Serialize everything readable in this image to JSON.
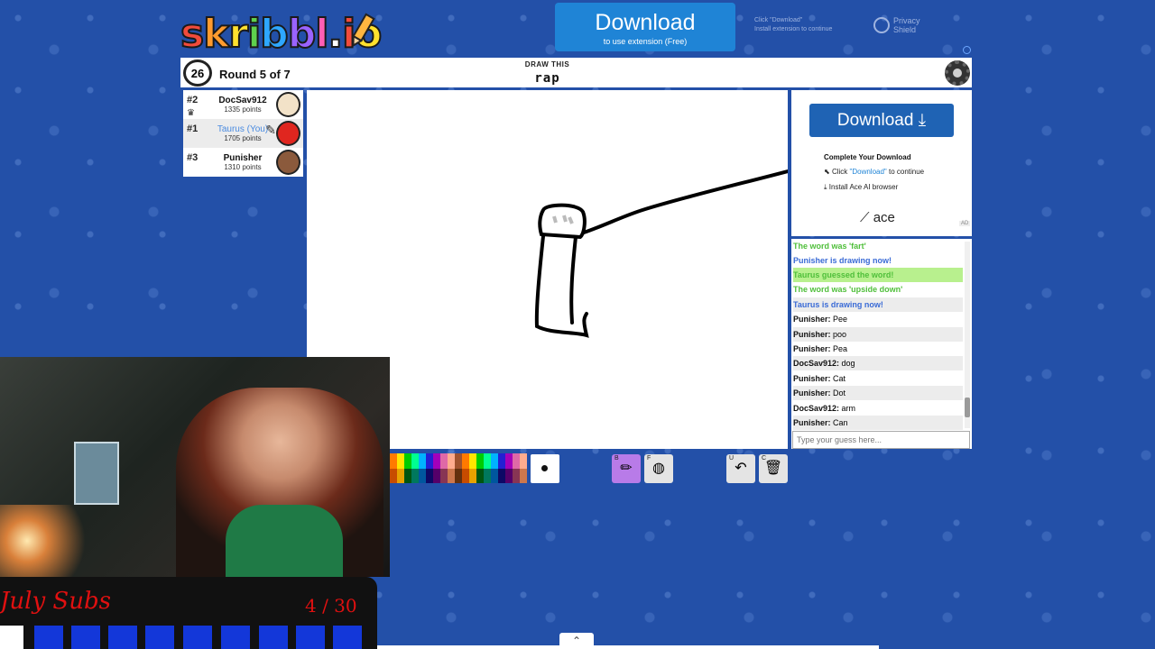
{
  "logo": {
    "text": "skribbl.io"
  },
  "top_ad": {
    "download_label": "Download",
    "sub_label": "to use extension (Free)",
    "extra_line1": "Click \"Download\"",
    "extra_line2": "Install extension to continue",
    "privacy_label": "Privacy Shield"
  },
  "game": {
    "timer": "26",
    "round_label": "Round 5 of 7",
    "draw_this": "DRAW THIS",
    "word": "rap"
  },
  "players": [
    {
      "rank": "#2",
      "name": "DocSav912",
      "points": "1335 points",
      "avatar_color": "#f2e2c8"
    },
    {
      "rank": "#1",
      "name": "Taurus (You)",
      "points": "1705 points",
      "avatar_color": "#e0261f",
      "is_you": true
    },
    {
      "rank": "#3",
      "name": "Punisher",
      "points": "1310 points",
      "avatar_color": "#8b5a3c"
    }
  ],
  "ad": {
    "download_label": "Download",
    "title": "Complete Your Download",
    "step1_pre": "Click ",
    "step1_hl": "\"Download\"",
    "step1_post": " to continue",
    "step2": "Install Ace AI browser",
    "brand": "ace",
    "badge": "AD"
  },
  "chat": {
    "messages": [
      {
        "type": "green",
        "text": "The word was 'fart'"
      },
      {
        "type": "blue",
        "text": "Punisher is drawing now!"
      },
      {
        "type": "guess",
        "text": "Taurus guessed the word!"
      },
      {
        "type": "green",
        "text": "The word was 'upside down'"
      },
      {
        "type": "blue",
        "text": "Taurus is drawing now!"
      },
      {
        "type": "chat",
        "user": "Punisher:",
        "text": " Pee"
      },
      {
        "type": "chat",
        "user": "Punisher:",
        "text": " poo"
      },
      {
        "type": "chat",
        "user": "Punisher:",
        "text": " Pea"
      },
      {
        "type": "chat",
        "user": "DocSav912:",
        "text": " dog"
      },
      {
        "type": "chat",
        "user": "Punisher:",
        "text": " Cat"
      },
      {
        "type": "chat",
        "user": "Punisher:",
        "text": " Dot"
      },
      {
        "type": "chat",
        "user": "DocSav912:",
        "text": " arm"
      },
      {
        "type": "chat",
        "user": "Punisher:",
        "text": " Can"
      }
    ],
    "input_placeholder": "Type your guess here..."
  },
  "toolbar": {
    "palette_row1": [
      "#ff7a00",
      "#ffe600",
      "#00cc00",
      "#00ff91",
      "#00b2ff",
      "#231fd3",
      "#a300ba",
      "#df69a7",
      "#ffac8e",
      "#a0522d",
      "#ff7a00",
      "#ffe600",
      "#00cc00",
      "#00ff91",
      "#00b2ff",
      "#231fd3",
      "#a300ba",
      "#df69a7",
      "#ffac8e"
    ],
    "palette_row2": [
      "#c74c00",
      "#e8a200",
      "#005510",
      "#00785d",
      "#00569e",
      "#0e0865",
      "#550069",
      "#873554",
      "#cc774d",
      "#63300d",
      "#c74c00",
      "#e8a200",
      "#005510",
      "#00785d",
      "#00569e",
      "#0e0865",
      "#550069",
      "#873554",
      "#cc774d"
    ],
    "brush_key": "B",
    "fill_key": "F",
    "undo_key": "U",
    "clear_key": "C"
  },
  "stream": {
    "subs_title": "July Subs",
    "subs_count": "4 / 30"
  }
}
